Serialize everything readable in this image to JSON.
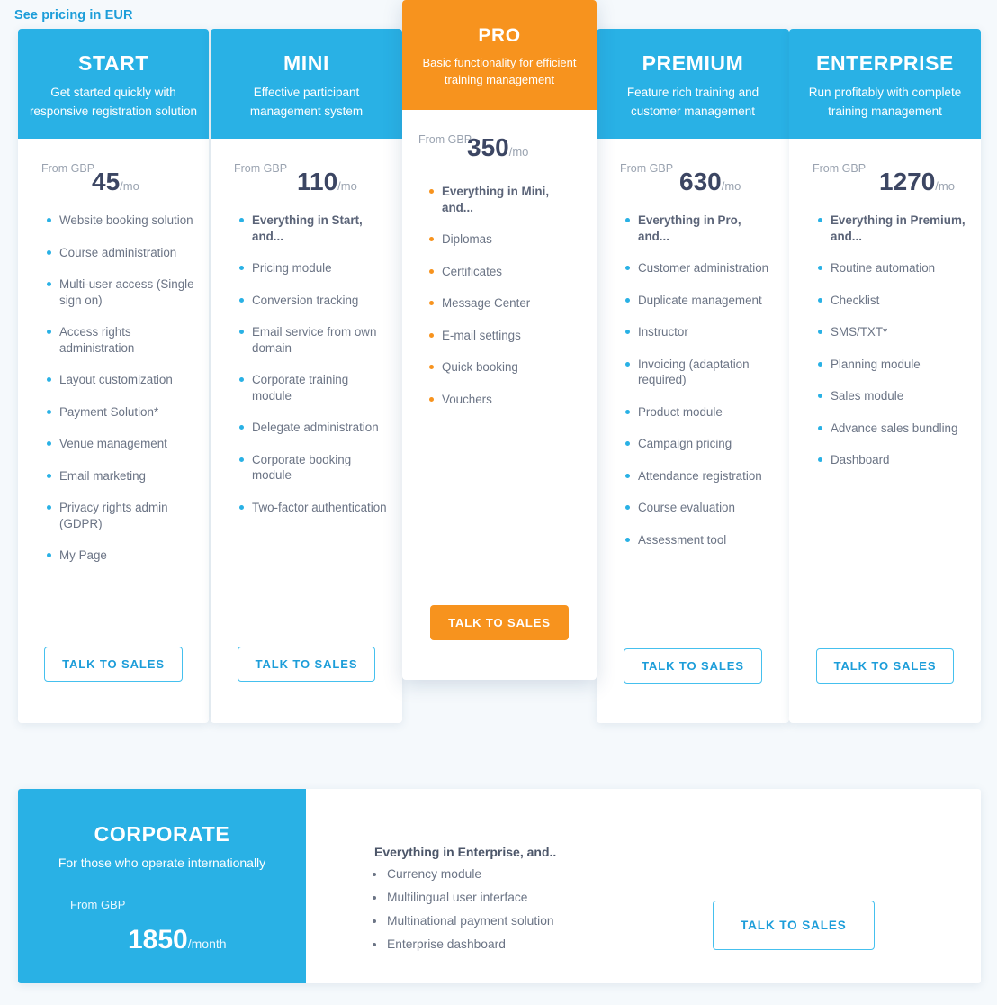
{
  "currency_link": {
    "label": "See pricing in EUR"
  },
  "cta_label": "TALK TO SALES",
  "colors": {
    "brand_blue": "#29b1e5",
    "link_blue": "#1c9dd9",
    "accent_orange": "#f7931e",
    "page_background": "#f5f9fc",
    "price_text": "#3c4663",
    "feature_text": "#6b7485",
    "muted_text": "#9aa3b0"
  },
  "plans": [
    {
      "name": "START",
      "tagline": "Get started quickly with responsive registration solution",
      "price_from": "From GBP",
      "price_amount": "45",
      "price_period": "/mo",
      "cta": "TALK TO SALES",
      "features": [
        "Website booking solution",
        "Course administration",
        "Multi-user access (Single sign on)",
        "Access rights administration",
        "Layout customization",
        "Payment Solution*",
        "Venue management",
        "Email marketing",
        "Privacy rights admin (GDPR)",
        "My Page"
      ]
    },
    {
      "name": "MINI",
      "tagline": "Effective participant management system",
      "price_from": "From GBP",
      "price_amount": "110",
      "price_period": "/mo",
      "cta": "TALK TO SALES",
      "features": [
        "Everything in Start, and...",
        "Pricing module",
        "Conversion tracking",
        "Email service from own domain",
        "Corporate training module",
        "Delegate administration",
        "Corporate booking module",
        "Two-factor authentication"
      ]
    },
    {
      "name": "PRO",
      "tagline": "Basic functionality for efficient training management",
      "price_from": "From GBP",
      "price_amount": "350",
      "price_period": "/mo",
      "cta": "TALK TO SALES",
      "features": [
        "Everything in Mini, and...",
        "Diplomas",
        "Certificates",
        "Message Center",
        "E-mail settings",
        "Quick booking",
        "Vouchers"
      ]
    },
    {
      "name": "PREMIUM",
      "tagline": "Feature rich training and customer management",
      "price_from": "From GBP",
      "price_amount": "630",
      "price_period": "/mo",
      "cta": "TALK TO SALES",
      "features": [
        "Everything in Pro, and...",
        "Customer administration",
        "Duplicate management",
        "Instructor",
        "Invoicing (adaptation required)",
        "Product module",
        "Campaign pricing",
        "Attendance registration",
        "Course evaluation",
        "Assessment tool"
      ]
    },
    {
      "name": "ENTERPRISE",
      "tagline": "Run profitably with complete training management",
      "price_from": "From GBP",
      "price_amount": "1270",
      "price_period": "/mo",
      "cta": "TALK TO SALES",
      "features": [
        "Everything in Premium, and...",
        "Routine automation",
        "Checklist",
        "SMS/TXT*",
        "Planning module",
        "Sales module",
        "Advance sales bundling",
        "Dashboard"
      ]
    }
  ],
  "corporate": {
    "name": "CORPORATE",
    "tagline": "For those who operate internationally",
    "price_from": "From GBP",
    "price_amount": "1850",
    "price_period": "/month",
    "intro": "Everything in Enterprise, and..",
    "cta": "TALK TO SALES",
    "features": [
      "Currency module",
      "Multilingual user interface",
      "Multinational payment solution",
      "Enterprise dashboard"
    ]
  }
}
